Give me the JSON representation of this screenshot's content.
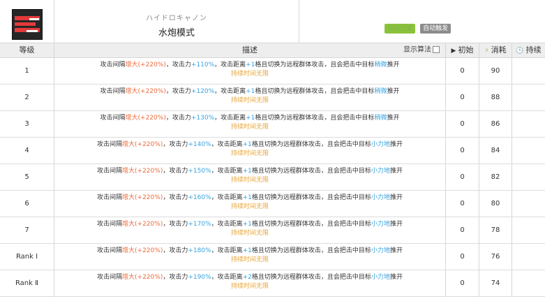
{
  "header": {
    "subtitle": "ハイドロキャノン",
    "title": "水炮模式",
    "tags": [
      {
        "label": "自动回复",
        "color": "#8cc33a"
      },
      {
        "label": "自动触发",
        "color": "#8c8c8c"
      }
    ],
    "icon": "skill-icon"
  },
  "table": {
    "headers": {
      "level": "等级",
      "description": "描述",
      "show_algorithm": "显示算法",
      "initial": "初始",
      "cost": "消耗",
      "duration": "持续"
    },
    "rows": [
      {
        "level": "1",
        "d1": "攻击间隔",
        "d2": "增大(+220%)",
        "d3": "，攻击力",
        "d4": "+110%",
        "d5": "，攻击距离",
        "d6": "+1",
        "d7": "格且切换为远程群体攻击，且会把击中目标",
        "d8": "稍微",
        "d9": "推开",
        "d10": "持续时间无限",
        "initial": "0",
        "cost": "90",
        "duration": ""
      },
      {
        "level": "2",
        "d1": "攻击间隔",
        "d2": "增大(+220%)",
        "d3": "，攻击力",
        "d4": "+120%",
        "d5": "，攻击距离",
        "d6": "+1",
        "d7": "格且切换为远程群体攻击，且会把击中目标",
        "d8": "稍微",
        "d9": "推开",
        "d10": "持续时间无限",
        "initial": "0",
        "cost": "88",
        "duration": ""
      },
      {
        "level": "3",
        "d1": "攻击间隔",
        "d2": "增大(+220%)",
        "d3": "，攻击力",
        "d4": "+130%",
        "d5": "，攻击距离",
        "d6": "+1",
        "d7": "格且切换为远程群体攻击，且会把击中目标",
        "d8": "稍微",
        "d9": "推开",
        "d10": "持续时间无限",
        "initial": "0",
        "cost": "86",
        "duration": ""
      },
      {
        "level": "4",
        "d1": "攻击间隔",
        "d2": "增大(+220%)",
        "d3": "，攻击力",
        "d4": "+140%",
        "d5": "，攻击距离",
        "d6": "+1",
        "d7": "格且切换为远程群体攻击，且会把击中目标",
        "d8": "小力地",
        "d9": "推开",
        "d10": "持续时间无限",
        "initial": "0",
        "cost": "84",
        "duration": ""
      },
      {
        "level": "5",
        "d1": "攻击间隔",
        "d2": "增大(+220%)",
        "d3": "，攻击力",
        "d4": "+150%",
        "d5": "，攻击距离",
        "d6": "+1",
        "d7": "格且切换为远程群体攻击，且会把击中目标",
        "d8": "小力地",
        "d9": "推开",
        "d10": "持续时间无限",
        "initial": "0",
        "cost": "82",
        "duration": ""
      },
      {
        "level": "6",
        "d1": "攻击间隔",
        "d2": "增大(+220%)",
        "d3": "，攻击力",
        "d4": "+160%",
        "d5": "，攻击距离",
        "d6": "+1",
        "d7": "格且切换为远程群体攻击，且会把击中目标",
        "d8": "小力地",
        "d9": "推开",
        "d10": "持续时间无限",
        "initial": "0",
        "cost": "80",
        "duration": ""
      },
      {
        "level": "7",
        "d1": "攻击间隔",
        "d2": "增大(+220%)",
        "d3": "，攻击力",
        "d4": "+170%",
        "d5": "，攻击距离",
        "d6": "+1",
        "d7": "格且切换为远程群体攻击，且会把击中目标",
        "d8": "小力地",
        "d9": "推开",
        "d10": "持续时间无限",
        "initial": "0",
        "cost": "78",
        "duration": ""
      },
      {
        "level": "Rank Ⅰ",
        "d1": "攻击间隔",
        "d2": "增大(+220%)",
        "d3": "，攻击力",
        "d4": "+180%",
        "d5": "，攻击距离",
        "d6": "+1",
        "d7": "格且切换为远程群体攻击，且会把击中目标",
        "d8": "小力地",
        "d9": "推开",
        "d10": "持续时间无限",
        "initial": "0",
        "cost": "76",
        "duration": ""
      },
      {
        "level": "Rank Ⅱ",
        "d1": "攻击间隔",
        "d2": "增大(+220%)",
        "d3": "，攻击力",
        "d4": "+190%",
        "d5": "，攻击距离",
        "d6": "+2",
        "d7": "格且切换为远程群体攻击，且会把击中目标",
        "d8": "小力地",
        "d9": "推开",
        "d10": "持续时间无限",
        "initial": "0",
        "cost": "74",
        "duration": ""
      }
    ]
  }
}
